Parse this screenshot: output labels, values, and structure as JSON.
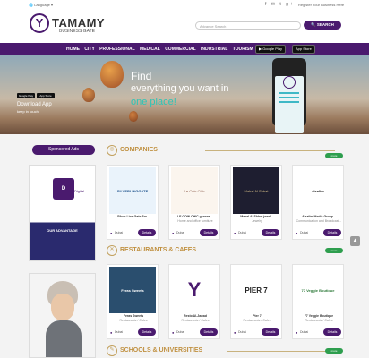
{
  "topbar": {
    "language": "Language",
    "social": "f ✉ t g+",
    "register": "Register Your Business Here"
  },
  "logo": {
    "letter": "Y",
    "name": "TAMAMY",
    "subtitle": "BUSINESS GATE"
  },
  "search": {
    "placeholder": "Advance Search",
    "button": "SEARCH"
  },
  "nav": {
    "items": [
      "HOME",
      "CITY",
      "PROFESSIONAL",
      "MEDICAL",
      "COMMERCIAL",
      "INDUSTRIAL",
      "TOURISM"
    ],
    "google_play": "Google Play",
    "app_store": "App Store"
  },
  "hero": {
    "line1": "Find",
    "line2": "everything you want in",
    "line3": "one place!",
    "download": "Download App",
    "keep": "keep in touch",
    "mini1": "Google Play",
    "mini2": "App Store"
  },
  "sponsored": {
    "label": "Sponsored Ads",
    "ad1_title": "Digital",
    "ad1_caption": "OUR ADVANTAGE"
  },
  "sections": [
    {
      "title": "COMPANIES",
      "icon": "companies-icon",
      "more": "more"
    },
    {
      "title": "RESTAURANTS & CAFES",
      "icon": "restaurant-icon",
      "more": "more"
    },
    {
      "title": "SCHOOLS & UNIVERSITIES",
      "icon": "school-icon",
      "more": "more"
    }
  ],
  "companies": [
    {
      "img": "SILVERLINGGATE",
      "name": "Silver Line Gate Fro...",
      "sub": "",
      "loc": "Dubai",
      "btn": "Details"
    },
    {
      "img": "Le Coin Chic",
      "name": "LE COIN CHIC general...",
      "sub": "Home and office furniture",
      "loc": "Dubai",
      "btn": "Details"
    },
    {
      "img": "Mahal Al Shbat",
      "name": "Mahal Al Shbat jewel...",
      "sub": "Jewelry",
      "loc": "Dubai",
      "btn": "Details"
    },
    {
      "img": "alsalim",
      "name": "Alsalim Media Group...",
      "sub": "Communication and Broadcast...",
      "loc": "Dubai",
      "btn": "Details"
    }
  ],
  "restaurants": [
    {
      "img": "Feras Sweets",
      "name": "Feras Sweets",
      "sub": "Restaurants / Cafes",
      "loc": "Dubai",
      "btn": "Details"
    },
    {
      "img": "Y",
      "name": "Resto Al-Jawad",
      "sub": "Restaurants / Cafes",
      "loc": "Dubai",
      "btn": "Details"
    },
    {
      "img": "PIER 7",
      "name": "Pier 7",
      "sub": "Restaurants / Cafes",
      "loc": "Dubai",
      "btn": "Details"
    },
    {
      "img": "77 Veggie Boutique",
      "name": "77 Veggie Boutique",
      "sub": "Restaurants / Cafes",
      "loc": "Dubai",
      "btn": "Details"
    }
  ],
  "colors": {
    "brand": "#4a1a6e",
    "accent": "#c09040",
    "more_green": "#2e9e4e"
  }
}
